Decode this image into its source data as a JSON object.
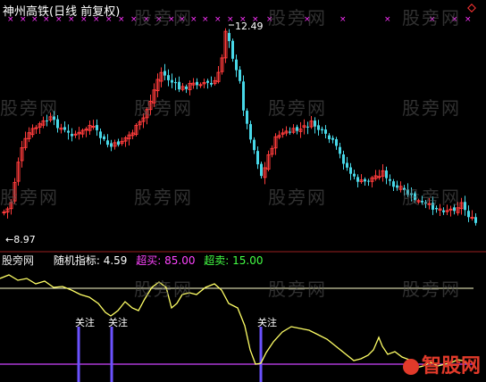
{
  "header": {
    "title": "神州高铁(日线 前复权)",
    "high_label": "12.49",
    "low_label": "8.97"
  },
  "indicator": {
    "pane_label": "股旁网",
    "name": "随机指标: ",
    "value": "4.59",
    "buy_label": "超买: ",
    "buy_value": "85.00",
    "sell_label": "超卖: ",
    "sell_value": "15.00",
    "attention_label": "关注"
  },
  "watermark": {
    "text": "股旁网"
  },
  "logo": {
    "text": "智股网"
  },
  "colors": {
    "background": "#000000",
    "up": "#ff3b3b",
    "down": "#48d8e8",
    "kdj_line": "#ffff66",
    "overbought_line": "#ffffcc",
    "oversold_line": "#cc44ff",
    "attention_bar": "#6b52ff",
    "marker": "#ff33ff",
    "buy_text": "#ff44ff",
    "sell_text": "#44ff44",
    "logo": "#e23a2a"
  },
  "chart_data": {
    "type": "candlestick",
    "price_range": [
      8.97,
      12.49
    ],
    "indicator_levels": {
      "overbought": 85,
      "oversold": 15
    },
    "indicator_last": 4.59
  }
}
